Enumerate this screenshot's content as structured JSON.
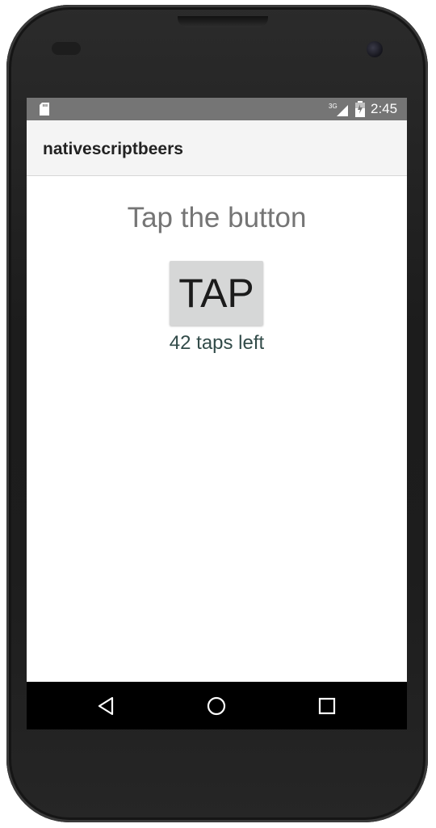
{
  "status_bar": {
    "network": "3G",
    "time": "2:45"
  },
  "action_bar": {
    "title": "nativescriptbeers"
  },
  "main": {
    "headline": "Tap the button",
    "tap_button_label": "TAP",
    "taps_left_text": "42 taps left"
  },
  "nav_bar": {
    "icons": [
      "back-icon",
      "home-icon",
      "recent-apps-icon"
    ]
  },
  "colors": {
    "status_bar": "#757575",
    "action_bar": "#f4f4f4",
    "headline_text": "#757575",
    "button_bg": "#d6d7d7",
    "taps_left_text": "#324b49",
    "nav_bar": "#000000"
  }
}
